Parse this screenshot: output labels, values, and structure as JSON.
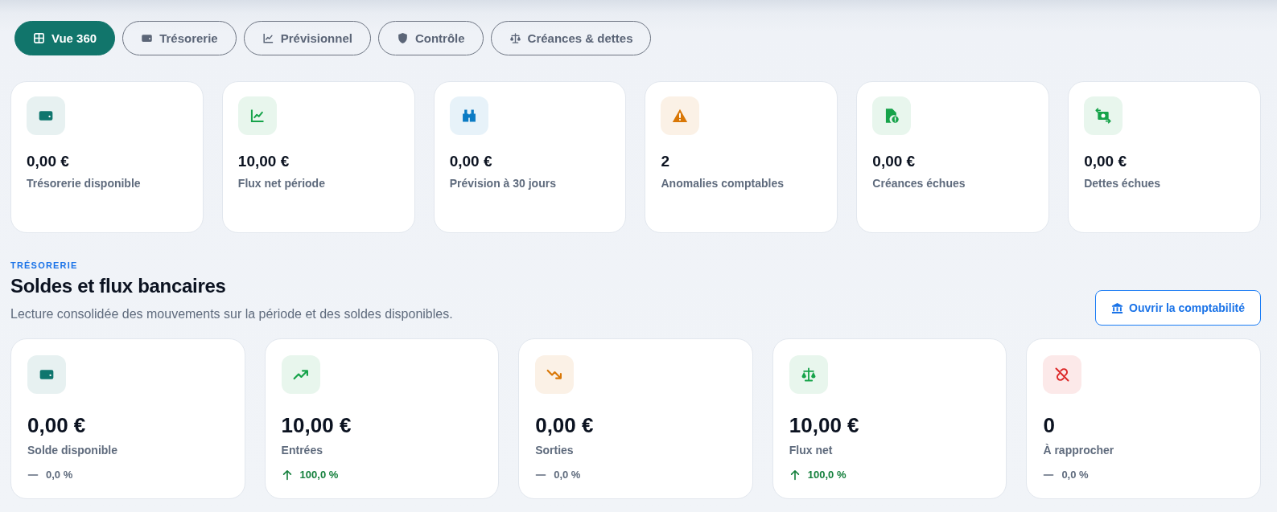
{
  "tabs": [
    {
      "label": "Vue 360",
      "selected": true
    },
    {
      "label": "Trésorerie",
      "selected": false
    },
    {
      "label": "Prévisionnel",
      "selected": false
    },
    {
      "label": "Contrôle",
      "selected": false
    },
    {
      "label": "Créances & dettes",
      "selected": false
    }
  ],
  "summary_cards": [
    {
      "value": "0,00 €",
      "label": "Trésorerie disponible",
      "color": "#0f766e"
    },
    {
      "value": "10,00 €",
      "label": "Flux net période",
      "color": "#16a34a"
    },
    {
      "value": "0,00 €",
      "label": "Prévision à 30 jours",
      "color": "#0b7bc4"
    },
    {
      "value": "2",
      "label": "Anomalies comptables",
      "color": "#d97706"
    },
    {
      "value": "0,00 €",
      "label": "Créances échues",
      "color": "#16a34a"
    },
    {
      "value": "0,00 €",
      "label": "Dettes échues",
      "color": "#16a34a"
    }
  ],
  "section": {
    "eyebrow": "TRÉSORERIE",
    "title": "Soldes et flux bancaires",
    "subtitle": "Lecture consolidée des mouvements sur la période et des soldes disponibles.",
    "button": "Ouvrir la comptabilité"
  },
  "metric_cards": [
    {
      "value": "0,00 €",
      "label": "Solde disponible",
      "color": "#0f766e",
      "change": {
        "kind": "flat",
        "text": "0,0 %"
      }
    },
    {
      "value": "10,00 €",
      "label": "Entrées",
      "color": "#16a34a",
      "change": {
        "kind": "up",
        "text": "100,0 %"
      }
    },
    {
      "value": "0,00 €",
      "label": "Sorties",
      "color": "#d97706",
      "change": {
        "kind": "flat",
        "text": "0,0 %"
      }
    },
    {
      "value": "10,00 €",
      "label": "Flux net",
      "color": "#16a34a",
      "change": {
        "kind": "up",
        "text": "100,0 %"
      }
    },
    {
      "value": "0",
      "label": "À rapprocher",
      "color": "#dc2626",
      "change": {
        "kind": "flat",
        "text": "0,0 %"
      }
    }
  ]
}
